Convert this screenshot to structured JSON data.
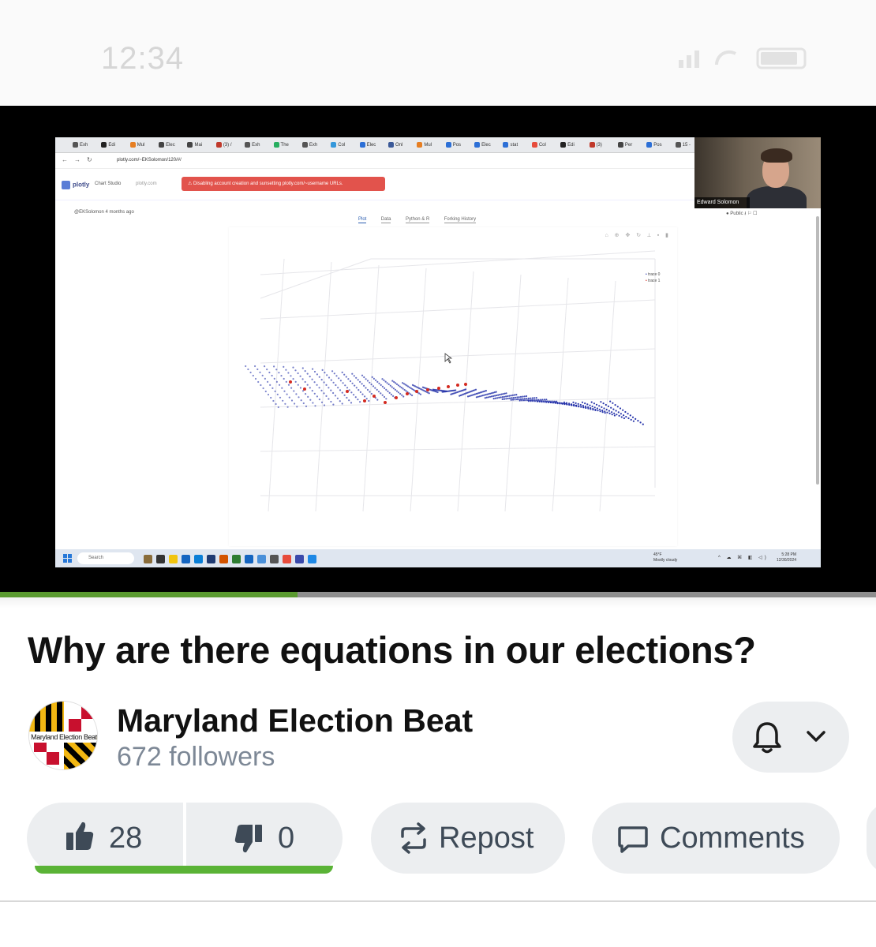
{
  "status_bar": {
    "time": "12:34"
  },
  "video": {
    "browser_tabs": [
      "Exh",
      "Edi",
      "Mul",
      "Elec",
      "Mai",
      "(3) /",
      "Exh",
      "The",
      "Exh",
      "Col",
      "Elec",
      "Onl",
      "Mul",
      "Pos",
      "Elec",
      "stat",
      "Col",
      "Edi",
      "(3)",
      "Per",
      "Pos",
      "15 -"
    ],
    "url": "plotly.com/~EKSolomon/120/#/",
    "plotly_logo": "plotly",
    "chart_studio": "Chart Studio",
    "plotly_domain": "plotly.com",
    "alert": "Disabling account creation and sunsetting plotly.com/~username URLs.",
    "webcam_name": "Edward Solomon",
    "author": "@EKSolomon 4 months ago",
    "plot_tabs": [
      "Plot",
      "Data",
      "Python & R",
      "Forking History"
    ],
    "public_label": "Public",
    "legend": [
      "trace 0",
      "trace 1"
    ],
    "taskbar_search": "Search",
    "weather_temp": "45°F",
    "weather_desc": "Mostly cloudy",
    "clock_time": "5:28 PM",
    "clock_date": "12/30/2024",
    "progress_fraction": 0.34
  },
  "post": {
    "title": "Why are there equations in our elections?",
    "channel_name": "Maryland Election Beat",
    "avatar_text": "Maryland Election Beat",
    "followers": "672 followers"
  },
  "actions": {
    "upvotes": "28",
    "downvotes": "0",
    "repost_label": "Repost",
    "comments_label": "Comments"
  },
  "colors": {
    "accent_green": "#5ab336",
    "progress_green": "#5a9a2f",
    "alert_red": "#e2534c",
    "muted_text": "#7d8896",
    "pill_bg": "#eceef0",
    "trace0_blue": "#1c2aa6",
    "trace1_red": "#d42a20"
  },
  "icons": [
    "thumbs-up-icon",
    "thumbs-down-icon",
    "repost-icon",
    "comment-icon",
    "bell-icon",
    "chevron-down-icon"
  ]
}
